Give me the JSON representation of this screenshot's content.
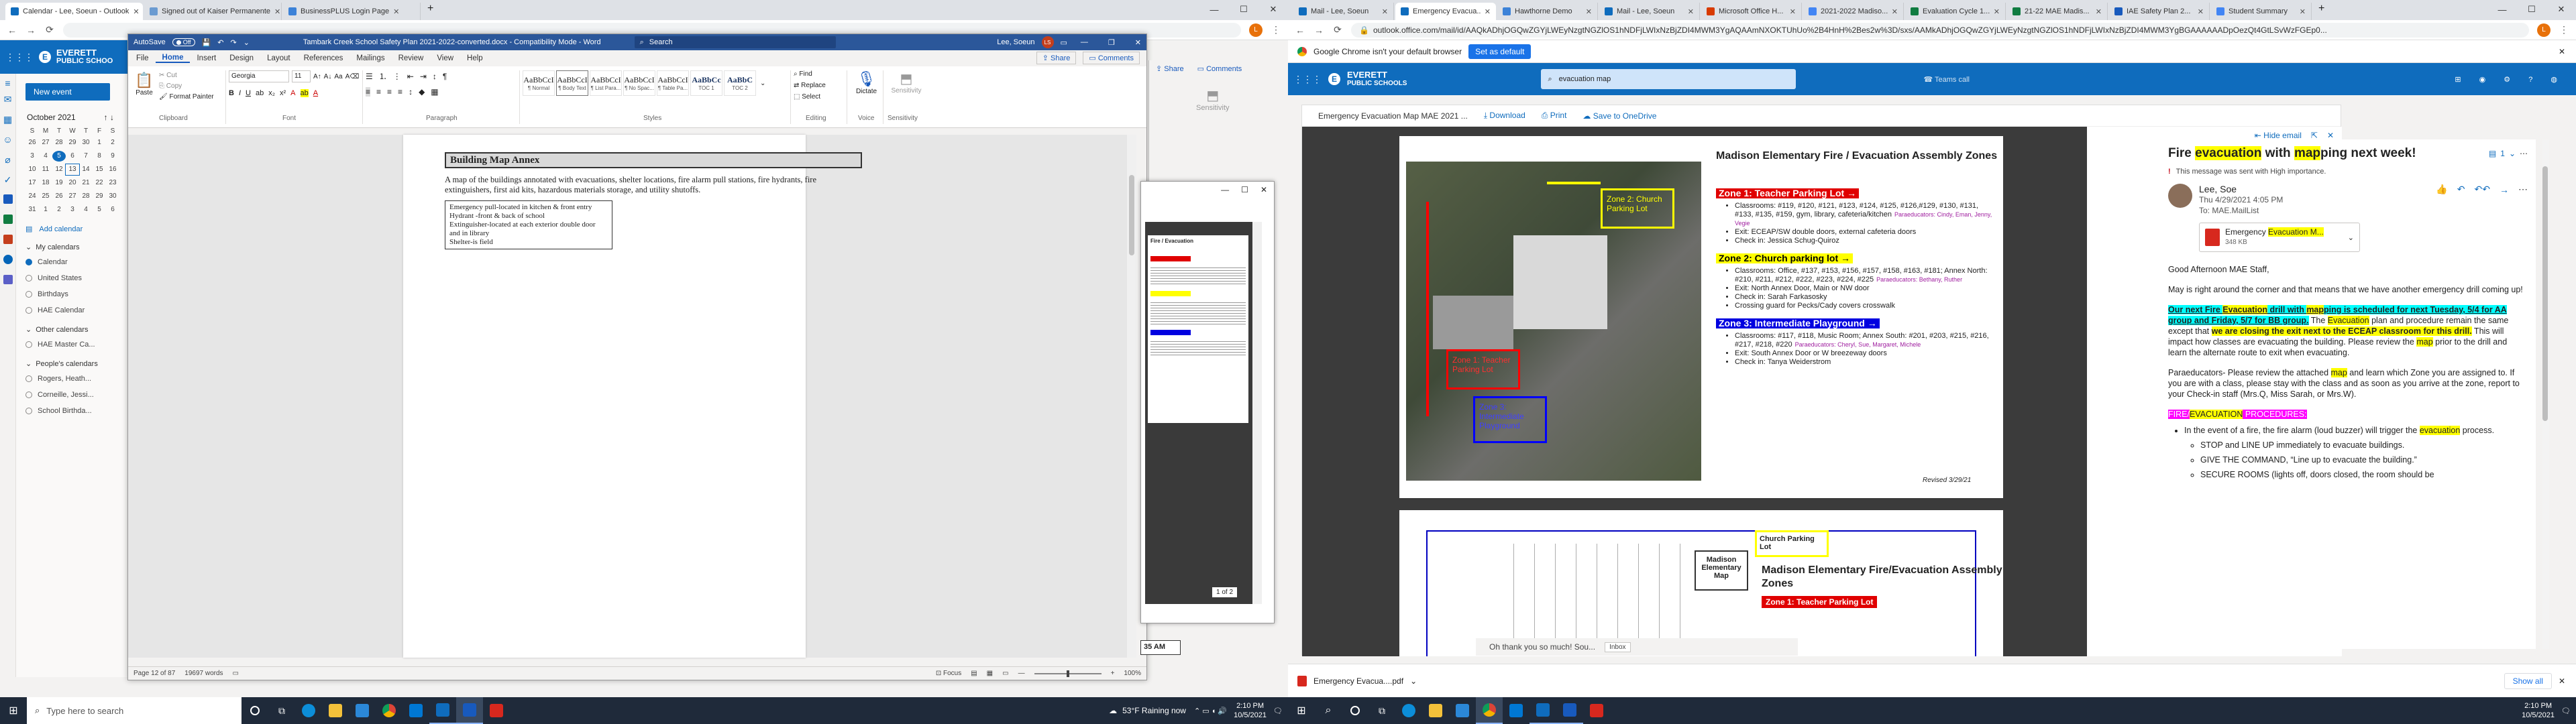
{
  "left_browser": {
    "tabs": [
      {
        "label": "Calendar - Lee, Soeun - Outlook",
        "color": "#0f6cbd",
        "active": true
      },
      {
        "label": "Signed out of Kaiser Permanente",
        "color": "#6b9bd1",
        "active": false
      },
      {
        "label": "BusinessPLUS Login Page",
        "color": "#3c82d8",
        "active": false
      }
    ],
    "url": "",
    "profile_initial": "L"
  },
  "outlook_cal": {
    "logo_line1": "EVERETT",
    "logo_line2": "PUBLIC SCHOO",
    "new_event": "New event",
    "month": "October 2021",
    "weekdays": [
      "S",
      "M",
      "T",
      "W",
      "T",
      "F",
      "S"
    ],
    "weeks": [
      [
        "26",
        "27",
        "28",
        "29",
        "30",
        "1",
        "2"
      ],
      [
        "3",
        "4",
        "5",
        "6",
        "7",
        "8",
        "9"
      ],
      [
        "10",
        "11",
        "12",
        "13",
        "14",
        "15",
        "16"
      ],
      [
        "17",
        "18",
        "19",
        "20",
        "21",
        "22",
        "23"
      ],
      [
        "24",
        "25",
        "26",
        "27",
        "28",
        "29",
        "30"
      ],
      [
        "31",
        "1",
        "2",
        "3",
        "4",
        "5",
        "6"
      ]
    ],
    "add_calendar": "Add calendar",
    "my_calendars": "My calendars",
    "my_cal_items": [
      "Calendar",
      "United States",
      "Birthdays",
      "HAE Calendar"
    ],
    "other_calendars": "Other calendars",
    "other_items": [
      "HAE Master Ca..."
    ],
    "peoples_calendars": "People's calendars",
    "people_items": [
      "Rogers, Heath...",
      "Corneille, Jessi...",
      "School Birthda..."
    ]
  },
  "word": {
    "autosave": "AutoSave",
    "autosave_state": "Off",
    "title": "Tambark Creek School Safety Plan 2021-2022-converted.docx - Compatibility Mode - Word",
    "search": "Search",
    "user": "Lee, Soeun",
    "user_initials": "LS",
    "tabs": [
      "File",
      "Home",
      "Insert",
      "Design",
      "Layout",
      "References",
      "Mailings",
      "Review",
      "View",
      "Help"
    ],
    "share": "Share",
    "comments": "Comments",
    "clipboard": {
      "paste": "Paste",
      "cut": "Cut",
      "copy": "Copy",
      "format_painter": "Format Painter",
      "label": "Clipboard"
    },
    "font": {
      "name": "Georgia",
      "size": "11",
      "label": "Font"
    },
    "paragraph_label": "Paragraph",
    "styles": [
      {
        "sample": "AaBbCcI",
        "name": "¶ Normal"
      },
      {
        "sample": "AaBbCcI",
        "name": "¶ Body Text"
      },
      {
        "sample": "AaBbCcI",
        "name": "¶ List Para..."
      },
      {
        "sample": "AaBbCcI",
        "name": "¶ No Spac..."
      },
      {
        "sample": "AaBbCcI",
        "name": "¶ Table Pa..."
      },
      {
        "sample": "AaBbCc",
        "name": "TOC 1"
      },
      {
        "sample": "AaBbC",
        "name": "TOC 2"
      }
    ],
    "styles_label": "Styles",
    "editing": {
      "find": "Find",
      "replace": "Replace",
      "select": "Select",
      "label": "Editing"
    },
    "voice": {
      "dictate": "Dictate",
      "label": "Voice"
    },
    "sensitivity": {
      "label": "Sensitivity"
    },
    "doc": {
      "heading": "Building Map Annex",
      "body": "A map of the buildings annotated with evacuations, shelter locations, fire alarm pull stations, fire hydrants, fire extinguishers, first aid kits, hazardous materials storage, and utility shutoffs.",
      "box_lines": [
        "Emergency pull-located in kitchen & front entry",
        "Hydrant -front & back of school",
        "Extinguisher-located at each exterior double door and in library",
        "Shelter-is field"
      ]
    },
    "status": {
      "page": "Page 12 of 87",
      "words": "19697 words",
      "focus": "Focus",
      "zoom": "100%",
      "ready": "Ready"
    }
  },
  "pdf_popup": {
    "heading": "Fire / Evacuation",
    "page": "1 of 2",
    "time": "35 AM"
  },
  "right_browser": {
    "tabs": [
      {
        "label": "Mail - Lee, Soeun",
        "color": "#0f6cbd",
        "active": false
      },
      {
        "label": "Emergency Evacua...",
        "color": "#0f6cbd",
        "active": true
      },
      {
        "label": "Hawthorne Demo",
        "color": "#3c82d8",
        "active": false
      },
      {
        "label": "Mail - Lee, Soeun",
        "color": "#0f6cbd",
        "active": false
      },
      {
        "label": "Microsoft Office H...",
        "color": "#d83b01",
        "active": false
      },
      {
        "label": "2021-2022 Madiso...",
        "color": "#4285f4",
        "active": false
      },
      {
        "label": "Evaluation Cycle 1...",
        "color": "#107c41",
        "active": false
      },
      {
        "label": "21-22 MAE Madis...",
        "color": "#107c41",
        "active": false
      },
      {
        "label": "IAE Safety Plan 2...",
        "color": "#185abd",
        "active": false
      },
      {
        "label": "Student Summary",
        "color": "#4285f4",
        "active": false
      }
    ],
    "url": "outlook.office.com/mail/id/AAQkADhjOGQwZGYjLWEyNzgtNGZlOS1hNDFjLWIxNzBjZDI4MWM3YgAQAAmNXOKTUhUo%2B4HnH%2Bes2w%3D/sxs/AAMkADhjOGQwZGYjLWEyNzgtNGZlOS1hNDFjLWIxNzBjZDI4MWM3YgBGAAAAAADpOezQt4GtLSvWzFGEp0...",
    "default_banner": "Google Chrome isn't your default browser",
    "set_default": "Set as default",
    "search_query": "evacuation map",
    "teams_call": "Teams call",
    "logo_line1": "EVERETT",
    "logo_line2": "PUBLIC SCHOOLS"
  },
  "pdf_viewer": {
    "title": "Emergency Evacuation Map MAE 2021 ...",
    "download": "Download",
    "print": "Print",
    "save_onedrive": "Save to OneDrive",
    "map_title": "Madison Elementary Fire / Evacuation Assembly Zones",
    "map_label_church": "Zone 2: Church Parking Lot",
    "map_label_teacher": "Zone 1: Teacher Parking Lot",
    "map_label_playground": "Zone 3: Intermediate Playground",
    "zones": [
      {
        "title": "Zone 1:  Teacher Parking Lot →",
        "color": "#e00000",
        "text_color": "#fff",
        "classrooms": "Classrooms: #119, #120, #121, #123, #124, #125, #126,#129, #130, #131, #133, #135, #159, gym, library, cafeteria/kitchen",
        "paras": "Paraeducators: Cindy, Eman, Jenny, Vegie",
        "exit": "Exit: ECEAP/SW double doors, external cafeteria doors",
        "checkin": "Check in:  Jessica Schug-Quiroz",
        "extra": ""
      },
      {
        "title": "Zone 2:  Church parking lot →",
        "color": "#ffff00",
        "text_color": "#000",
        "classrooms": "Classrooms: Office, #137, #153, #156, #157, #158, #163, #181; Annex North: #210, #211, #212, #222, #223, #224, #225",
        "paras": "Paraeducators: Bethany, Ruther",
        "exit": "Exit: North Annex Door, Main or NW door",
        "checkin": "Check in:  Sarah Farkasosky",
        "extra": "Crossing guard for Pecks/Cady covers crosswalk"
      },
      {
        "title": "Zone 3:  Intermediate Playground →",
        "color": "#0000e0",
        "text_color": "#fff",
        "classrooms": "Classrooms: #117, #118, Music Room; Annex South: #201, #203, #215, #216, #217, #218, #220",
        "paras": "Paraeducators: Cheryl, Sue, Margaret, Michele",
        "exit": "Exit: South Annex Door or W breezeway doors",
        "checkin": "Check in:  Tanya Weiderstrom",
        "extra": ""
      }
    ],
    "revised": "Revised 3/29/21",
    "page2_title": "Madison Elementary Fire/Evacuation Assembly Zones",
    "page2_church": "Church Parking Lot",
    "page2_mapbox": "Madison Elementary Map",
    "page2_zone1": "Zone 1:  Teacher Parking Lot"
  },
  "email": {
    "hide_email": "Hide email",
    "subject_parts": [
      {
        "t": "Fire ",
        "h": ""
      },
      {
        "t": "evacuation",
        "h": "yel"
      },
      {
        "t": " with ",
        "h": ""
      },
      {
        "t": "map",
        "h": "yel"
      },
      {
        "t": "ping next week!",
        "h": ""
      }
    ],
    "count": "1",
    "importance": "This message was sent with High importance.",
    "sender": "Lee, Soe",
    "date": "Thu 4/29/2021 4:05 PM",
    "to": "To:  MAE.MailList",
    "attachment_name": "Emergency Evacuation M...",
    "attachment_size": "348 KB",
    "greeting": "Good Afternoon MAE Staff,",
    "para1": "May is right around the corner and that means that we have another emergency drill coming up!",
    "para2_parts": [
      {
        "t": "Our next Fire ",
        "h": "cy",
        "b": true,
        "u": true
      },
      {
        "t": "Evacuation",
        "h": "yel",
        "b": true,
        "u": true
      },
      {
        "t": " drill with ",
        "h": "cy",
        "b": true,
        "u": true
      },
      {
        "t": "map",
        "h": "yel",
        "b": true,
        "u": true
      },
      {
        "t": "ping is scheduled for next Tuesday, 5/4 for AA group and Friday, 5/7 for BB group.",
        "h": "cy",
        "b": true,
        "u": true
      },
      {
        "t": " The ",
        "h": "",
        "b": false,
        "u": false
      },
      {
        "t": "Evacuation",
        "h": "yel",
        "b": false,
        "u": false
      },
      {
        "t": " plan and procedure remain the same except that ",
        "h": "",
        "b": false,
        "u": false
      },
      {
        "t": "we are closing the exit next to the ECEAP classroom for this drill.",
        "h": "yel",
        "b": true,
        "u": false
      },
      {
        "t": " This will impact how classes are evacuating the building. Please review the ",
        "h": "",
        "b": false,
        "u": false
      },
      {
        "t": "map",
        "h": "yel",
        "b": false,
        "u": false
      },
      {
        "t": " prior to the drill and learn the alternate route to exit when evacuating.",
        "h": "",
        "b": false,
        "u": false
      }
    ],
    "para3_parts": [
      {
        "t": "Paraeducators- Please review the attached ",
        "h": ""
      },
      {
        "t": "map",
        "h": "yel"
      },
      {
        "t": " and learn which Zone you are assigned to. If you are with a class, please stay with the class and as soon as you arrive at the zone, report to your Check-in staff (Mrs.Q, Miss Sarah, or Mrs.W).",
        "h": ""
      }
    ],
    "procedures_parts": [
      {
        "t": "FIRE/",
        "h": "mag"
      },
      {
        "t": "EVACUATION",
        "h": "yel"
      },
      {
        "t": " PROCEDURES:",
        "h": "mag"
      }
    ],
    "bullet1_parts": [
      {
        "t": "In the event of a fire, the fire alarm (loud buzzer) will trigger the ",
        "h": ""
      },
      {
        "t": "evacuation",
        "h": "yel"
      },
      {
        "t": " process.",
        "h": ""
      }
    ],
    "sub_bullets": [
      "STOP and LINE UP immediately to evacuate buildings.",
      "GIVE THE COMMAND, “Line up to evacuate the building.”",
      "SECURE ROOMS (lights off, doors closed, the room should be"
    ]
  },
  "teams_toast": {
    "text": "Oh thank you so much! Sou...",
    "action": "Inbox"
  },
  "downloads": {
    "file": "Emergency Evacua....pdf",
    "show_all": "Show all"
  },
  "taskbar_left": {
    "search": "Type here to search",
    "weather": "53°F  Raining now",
    "time": "2:10 PM",
    "date": "10/5/2021"
  },
  "taskbar_right": {
    "time": "2:10 PM",
    "date": "10/5/2021"
  }
}
